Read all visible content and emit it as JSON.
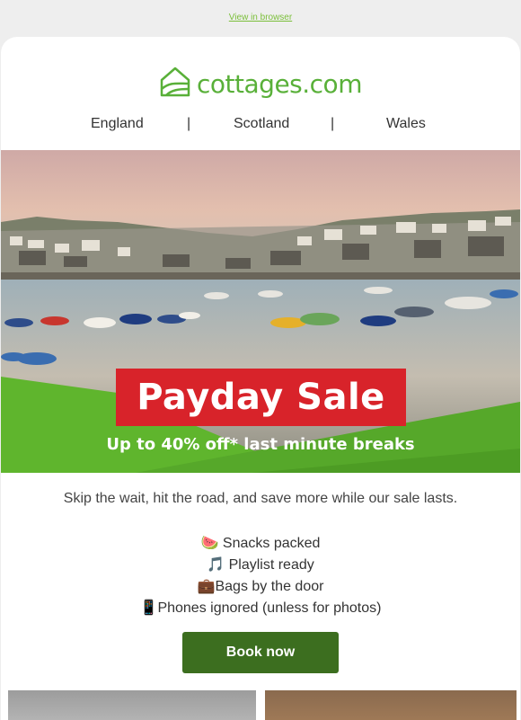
{
  "header": {
    "view_in_browser": "View in browser"
  },
  "logo": {
    "name": "cottages",
    "suffix": ".com",
    "icon": "house-icon"
  },
  "nav": {
    "items": [
      "England",
      "Scotland",
      "Wales"
    ],
    "separator": "|"
  },
  "hero": {
    "title": "Payday Sale",
    "subtitle": "Up to 40% off* last minute breaks"
  },
  "body": {
    "intro": "Skip the wait, hit the road, and save more while our sale lasts.",
    "list": [
      {
        "icon": "🍉",
        "text": " Snacks packed"
      },
      {
        "icon": "🎵",
        "text": " Playlist ready"
      },
      {
        "icon": "💼",
        "text": "Bags by the door"
      },
      {
        "icon": "📱",
        "text": "Phones ignored (unless for photos)"
      }
    ],
    "cta": "Book now"
  },
  "colors": {
    "brand_green": "#59b039",
    "cta_green": "#3c6e1f",
    "sale_red": "#d8232a"
  }
}
